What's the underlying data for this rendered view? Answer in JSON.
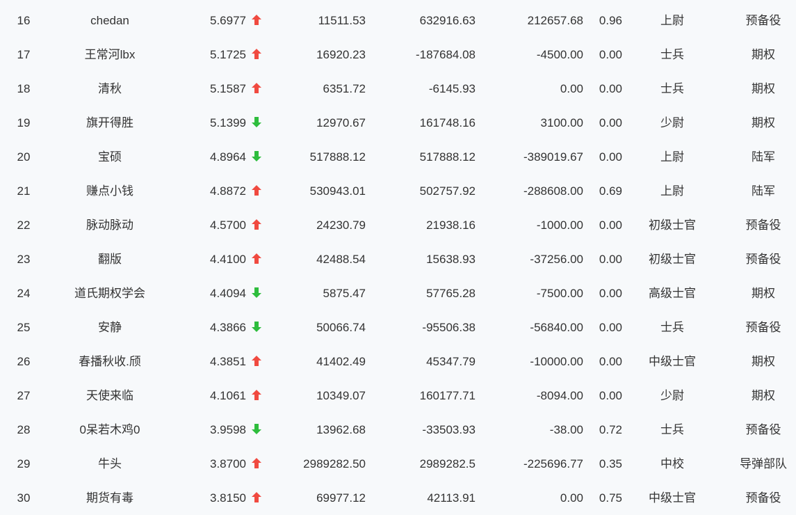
{
  "colors": {
    "up": "#f04a40",
    "down": "#2ebd3d",
    "text": "#333333",
    "background": "#f7f9fb"
  },
  "rows": [
    {
      "rank": "16",
      "name": "chedan",
      "score": "5.6977",
      "trend": "up",
      "v1": "11511.53",
      "v2": "632916.63",
      "v3": "212657.68",
      "ratio": "0.96",
      "title": "上尉",
      "unit": "预备役"
    },
    {
      "rank": "17",
      "name": "王常河lbx",
      "score": "5.1725",
      "trend": "up",
      "v1": "16920.23",
      "v2": "-187684.08",
      "v3": "-4500.00",
      "ratio": "0.00",
      "title": "士兵",
      "unit": "期权"
    },
    {
      "rank": "18",
      "name": "清秋",
      "score": "5.1587",
      "trend": "up",
      "v1": "6351.72",
      "v2": "-6145.93",
      "v3": "0.00",
      "ratio": "0.00",
      "title": "士兵",
      "unit": "期权"
    },
    {
      "rank": "19",
      "name": "旗开得胜",
      "score": "5.1399",
      "trend": "down",
      "v1": "12970.67",
      "v2": "161748.16",
      "v3": "3100.00",
      "ratio": "0.00",
      "title": "少尉",
      "unit": "期权"
    },
    {
      "rank": "20",
      "name": "宝硕",
      "score": "4.8964",
      "trend": "down",
      "v1": "517888.12",
      "v2": "517888.12",
      "v3": "-389019.67",
      "ratio": "0.00",
      "title": "上尉",
      "unit": "陆军"
    },
    {
      "rank": "21",
      "name": "赚点小钱",
      "score": "4.8872",
      "trend": "up",
      "v1": "530943.01",
      "v2": "502757.92",
      "v3": "-288608.00",
      "ratio": "0.69",
      "title": "上尉",
      "unit": "陆军"
    },
    {
      "rank": "22",
      "name": "脉动脉动",
      "score": "4.5700",
      "trend": "up",
      "v1": "24230.79",
      "v2": "21938.16",
      "v3": "-1000.00",
      "ratio": "0.00",
      "title": "初级士官",
      "unit": "预备役"
    },
    {
      "rank": "23",
      "name": "翻版",
      "score": "4.4100",
      "trend": "up",
      "v1": "42488.54",
      "v2": "15638.93",
      "v3": "-37256.00",
      "ratio": "0.00",
      "title": "初级士官",
      "unit": "预备役"
    },
    {
      "rank": "24",
      "name": "道氏期权学会",
      "score": "4.4094",
      "trend": "down",
      "v1": "5875.47",
      "v2": "57765.28",
      "v3": "-7500.00",
      "ratio": "0.00",
      "title": "高级士官",
      "unit": "期权"
    },
    {
      "rank": "25",
      "name": "安静",
      "score": "4.3866",
      "trend": "down",
      "v1": "50066.74",
      "v2": "-95506.38",
      "v3": "-56840.00",
      "ratio": "0.00",
      "title": "士兵",
      "unit": "预备役"
    },
    {
      "rank": "26",
      "name": "春播秋收.颀",
      "score": "4.3851",
      "trend": "up",
      "v1": "41402.49",
      "v2": "45347.79",
      "v3": "-10000.00",
      "ratio": "0.00",
      "title": "中级士官",
      "unit": "期权"
    },
    {
      "rank": "27",
      "name": "天使来临",
      "score": "4.1061",
      "trend": "up",
      "v1": "10349.07",
      "v2": "160177.71",
      "v3": "-8094.00",
      "ratio": "0.00",
      "title": "少尉",
      "unit": "期权"
    },
    {
      "rank": "28",
      "name": "0呆若木鸡0",
      "score": "3.9598",
      "trend": "down",
      "v1": "13962.68",
      "v2": "-33503.93",
      "v3": "-38.00",
      "ratio": "0.72",
      "title": "士兵",
      "unit": "预备役"
    },
    {
      "rank": "29",
      "name": "牛头",
      "score": "3.8700",
      "trend": "up",
      "v1": "2989282.50",
      "v2": "2989282.5",
      "v3": "-225696.77",
      "ratio": "0.35",
      "title": "中校",
      "unit": "导弹部队"
    },
    {
      "rank": "30",
      "name": "期货有毒",
      "score": "3.8150",
      "trend": "up",
      "v1": "69977.12",
      "v2": "42113.91",
      "v3": "0.00",
      "ratio": "0.75",
      "title": "中级士官",
      "unit": "预备役"
    }
  ]
}
